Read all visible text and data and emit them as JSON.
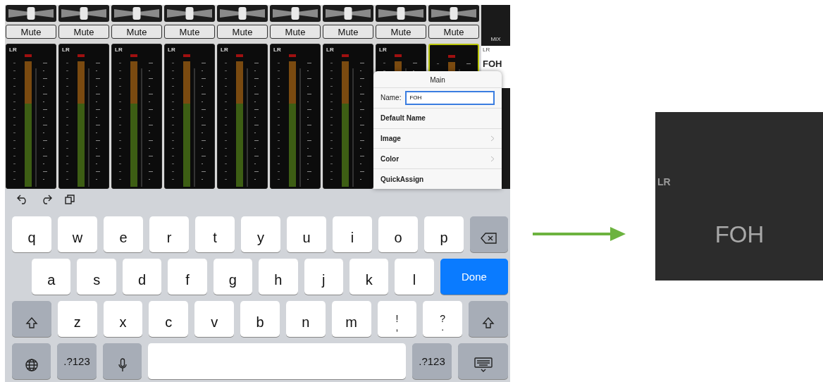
{
  "strips": [
    {
      "level": 0.5,
      "mute": "Mute",
      "muted": false,
      "meter_label": "LR",
      "selected": false
    },
    {
      "level": 0.5,
      "mute": "Mute",
      "muted": false,
      "meter_label": "LR",
      "selected": false
    },
    {
      "level": 0.5,
      "mute": "Mute",
      "muted": false,
      "meter_label": "LR",
      "selected": false
    },
    {
      "level": 0.5,
      "mute": "Mute",
      "muted": false,
      "meter_label": "LR",
      "selected": false
    },
    {
      "level": 0.5,
      "mute": "Mute",
      "muted": false,
      "meter_label": "LR",
      "selected": false
    },
    {
      "level": 0.5,
      "mute": "Mute",
      "muted": false,
      "meter_label": "LR",
      "selected": false
    },
    {
      "level": 0.5,
      "mute": "Mute",
      "muted": false,
      "meter_label": "LR",
      "selected": false
    },
    {
      "level": 0.5,
      "mute": "Mute",
      "muted": false,
      "meter_label": "LR",
      "selected": false
    },
    {
      "level": 0.5,
      "mute": "Mute",
      "muted": false,
      "selected": true
    }
  ],
  "mix_panel": {
    "heading": "MIX",
    "bus": "LR",
    "name": "FOH"
  },
  "popover": {
    "title": "Main",
    "name_label": "Name:",
    "name_value": "FOH",
    "rows": [
      {
        "label": "Default Name",
        "chevron": false
      },
      {
        "label": "Image",
        "chevron": true
      },
      {
        "label": "Color",
        "chevron": true
      },
      {
        "label": "QuickAssign",
        "chevron": false
      }
    ]
  },
  "keyboard": {
    "rows": [
      [
        {
          "kind": "letter",
          "label": "q"
        },
        {
          "kind": "letter",
          "label": "w"
        },
        {
          "kind": "letter",
          "label": "e"
        },
        {
          "kind": "letter",
          "label": "r"
        },
        {
          "kind": "letter",
          "label": "t"
        },
        {
          "kind": "letter",
          "label": "y"
        },
        {
          "kind": "letter",
          "label": "u"
        },
        {
          "kind": "letter",
          "label": "i"
        },
        {
          "kind": "letter",
          "label": "o"
        },
        {
          "kind": "letter",
          "label": "p"
        },
        {
          "kind": "backspace"
        }
      ],
      [
        {
          "kind": "letter",
          "label": "a"
        },
        {
          "kind": "letter",
          "label": "s"
        },
        {
          "kind": "letter",
          "label": "d"
        },
        {
          "kind": "letter",
          "label": "f"
        },
        {
          "kind": "letter",
          "label": "g"
        },
        {
          "kind": "letter",
          "label": "h"
        },
        {
          "kind": "letter",
          "label": "j"
        },
        {
          "kind": "letter",
          "label": "k"
        },
        {
          "kind": "letter",
          "label": "l"
        },
        {
          "kind": "done",
          "label": "Done"
        }
      ],
      [
        {
          "kind": "shift"
        },
        {
          "kind": "letter",
          "label": "z"
        },
        {
          "kind": "letter",
          "label": "x"
        },
        {
          "kind": "letter",
          "label": "c"
        },
        {
          "kind": "letter",
          "label": "v"
        },
        {
          "kind": "letter",
          "label": "b"
        },
        {
          "kind": "letter",
          "label": "n"
        },
        {
          "kind": "letter",
          "label": "m"
        },
        {
          "kind": "punct",
          "label": "!",
          "sublabel": ","
        },
        {
          "kind": "punct",
          "label": "?",
          "sublabel": "."
        },
        {
          "kind": "shift"
        }
      ],
      [
        {
          "kind": "globe"
        },
        {
          "kind": "numbers",
          "label": ".?123"
        },
        {
          "kind": "mic"
        },
        {
          "kind": "space"
        },
        {
          "kind": "numbers",
          "label": ".?123"
        },
        {
          "kind": "hide"
        }
      ]
    ]
  },
  "preview": {
    "bus": "LR",
    "name": "FOH"
  }
}
